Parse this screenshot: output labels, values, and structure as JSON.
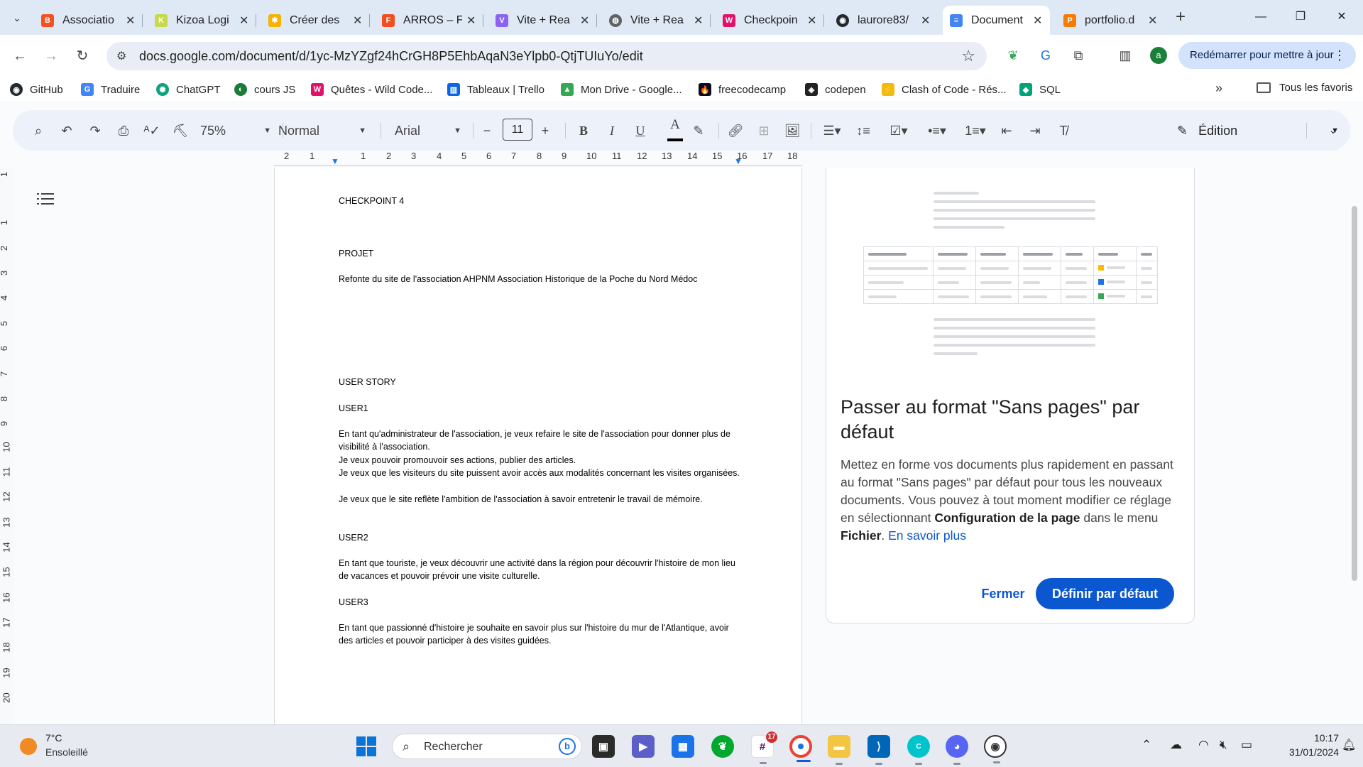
{
  "browser": {
    "tabs": [
      {
        "label": "Associatio",
        "icon": "blogger-icon",
        "color": "#f4511e"
      },
      {
        "label": "Kizoa Logi",
        "icon": "kizoa-icon",
        "color": "#c5d94b"
      },
      {
        "label": "Créer des",
        "icon": "pinwheel-icon",
        "color": "#f4b400"
      },
      {
        "label": "ARROS – F",
        "icon": "figma-icon",
        "color": "#f24e1e"
      },
      {
        "label": "Vite + Rea",
        "icon": "vite-icon",
        "color": "#8a63f2"
      },
      {
        "label": "Vite + Rea",
        "icon": "globe-icon",
        "color": "#5f6368"
      },
      {
        "label": "Checkpoin",
        "icon": "wild-code-icon",
        "color": "#e2126b"
      },
      {
        "label": "laurore83/",
        "icon": "github-icon",
        "color": "#24292f"
      },
      {
        "label": "Document",
        "icon": "docs-icon",
        "color": "#4285f4",
        "active": true
      },
      {
        "label": "portfolio.d",
        "icon": "portfolio-icon",
        "color": "#f57c00"
      }
    ],
    "address_url": "docs.google.com/document/d/1yc-MzYZgf24hCrGH8P5EhbAqaN3eYlpb0-QtjTUIuYo/edit",
    "profile_initial": "a",
    "update_label": "Redémarrer pour mettre à jour",
    "bookmarks": [
      {
        "label": "GitHub",
        "icon": "github-icon",
        "color": "#24292f"
      },
      {
        "label": "Traduire",
        "icon": "translate-icon",
        "color": "#4285f4"
      },
      {
        "label": "ChatGPT",
        "icon": "chatgpt-icon",
        "color": "#10a37f"
      },
      {
        "label": "cours JS",
        "icon": "course-icon",
        "color": "#1b7c3a"
      },
      {
        "label": "Quêtes - Wild Code...",
        "icon": "wild-code-icon",
        "color": "#e2126b"
      },
      {
        "label": "Tableaux | Trello",
        "icon": "trello-icon",
        "color": "#0c66e4"
      },
      {
        "label": "Mon Drive - Google...",
        "icon": "drive-icon",
        "color": "#34a853"
      },
      {
        "label": "freecodecamp",
        "icon": "freecodecamp-icon",
        "color": "#0a0a23"
      },
      {
        "label": "codepen",
        "icon": "codepen-icon",
        "color": "#222222"
      },
      {
        "label": "Clash of Code - Rés...",
        "icon": "clash-icon",
        "color": "#f2bb13"
      },
      {
        "label": "SQL",
        "icon": "sql-icon",
        "color": "#00a37a"
      }
    ],
    "all_bookmarks_label": "Tous les favoris"
  },
  "toolbar": {
    "zoom": "75%",
    "style": "Normal",
    "font": "Arial",
    "font_size": "11",
    "bold": "B",
    "italic": "I",
    "underline": "U",
    "text_color": "A",
    "mode": "Édition"
  },
  "ruler": {
    "h_ticks": [
      "2",
      "1",
      "1",
      "2",
      "3",
      "4",
      "5",
      "6",
      "7",
      "8",
      "9",
      "10",
      "11",
      "12",
      "13",
      "14",
      "15",
      "16",
      "17",
      "18"
    ],
    "v_ticks": [
      "1",
      "1",
      "2",
      "3",
      "4",
      "5",
      "6",
      "7",
      "8",
      "9",
      "10",
      "11",
      "12",
      "13",
      "14",
      "15",
      "16",
      "17",
      "18",
      "19",
      "20"
    ]
  },
  "document": {
    "title_line": "CHECKPOINT 4",
    "projet_heading": "PROJET",
    "projet_text": "Refonte du site de l'association AHPNM Association Historique de la Poche du Nord Médoc",
    "user_story_heading": "USER STORY",
    "user1_heading": "USER1",
    "user1_text": "En tant qu'administrateur de l'association, je veux refaire le site de l'association pour donner plus de visibilité à l'association.",
    "user1_line2": "Je veux pouvoir promouvoir ses actions, publier des articles.",
    "user1_line3": "Je veux que les visiteurs du site puissent avoir accès aux modalités concernant les visites organisées.",
    "user1_line4": "Je veux que le site reflète l'ambition de l'association à savoir entretenir le travail de mémoire.",
    "user2_heading": "USER2",
    "user2_text": "En tant que touriste, je veux découvrir une activité dans la région pour découvrir l'histoire de mon lieu de vacances et pouvoir prévoir une visite culturelle.",
    "user3_heading": "USER3",
    "user3_text": "En tant que passionné d'histoire je souhaite en savoir plus sur l'histoire du mur de l'Atlantique, avoir des articles et pouvoir participer à des visites guidées."
  },
  "dialog": {
    "title": "Passer au format \"Sans pages\" par défaut",
    "desc_part1": "Mettez en forme vos documents plus rapidement en passant au format \"Sans pages\" par défaut pour tous les nouveaux documents. Vous pouvez à tout moment modifier ce réglage en sélectionnant ",
    "desc_bold1": "Configuration de la page",
    "desc_part2": " dans le menu ",
    "desc_bold2": "Fichier",
    "desc_part3": ". ",
    "desc_link": "En savoir plus",
    "close_label": "Fermer",
    "default_label": "Définir par défaut",
    "illustration_status_colors": [
      "#fbbc04",
      "#1a73e8",
      "#34a853"
    ]
  },
  "taskbar": {
    "temperature": "7°C",
    "weather": "Ensoleillé",
    "search_placeholder": "Rechercher",
    "slack_badge": "17",
    "time": "10:17",
    "date": "31/01/2024"
  }
}
